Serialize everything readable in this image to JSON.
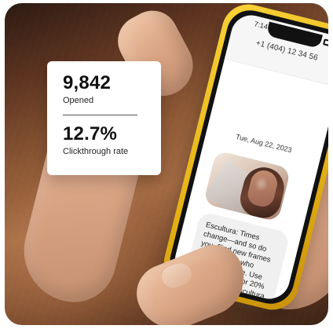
{
  "metrics": {
    "opened_value": "9,842",
    "opened_label": "Opened",
    "ctr_value": "12.7%",
    "ctr_label": "Clickthrough rate"
  },
  "phone": {
    "status_time": "7:14",
    "contact_number": "+1 (404) 12 34 56",
    "date": "Tue, Aug 22, 2023",
    "message_text": "Escultura: Times change—and so do you. Find new frames that express who you've become. Use code NEW23 for 20% off your next Escultura pair."
  },
  "colors": {
    "phone_case": "#e6b315",
    "card_bg": "#ffffff",
    "bubble_bg": "#f0f0f0"
  },
  "icons": {
    "signal": "signal-icon",
    "wifi": "wifi-icon",
    "battery": "battery-icon"
  }
}
